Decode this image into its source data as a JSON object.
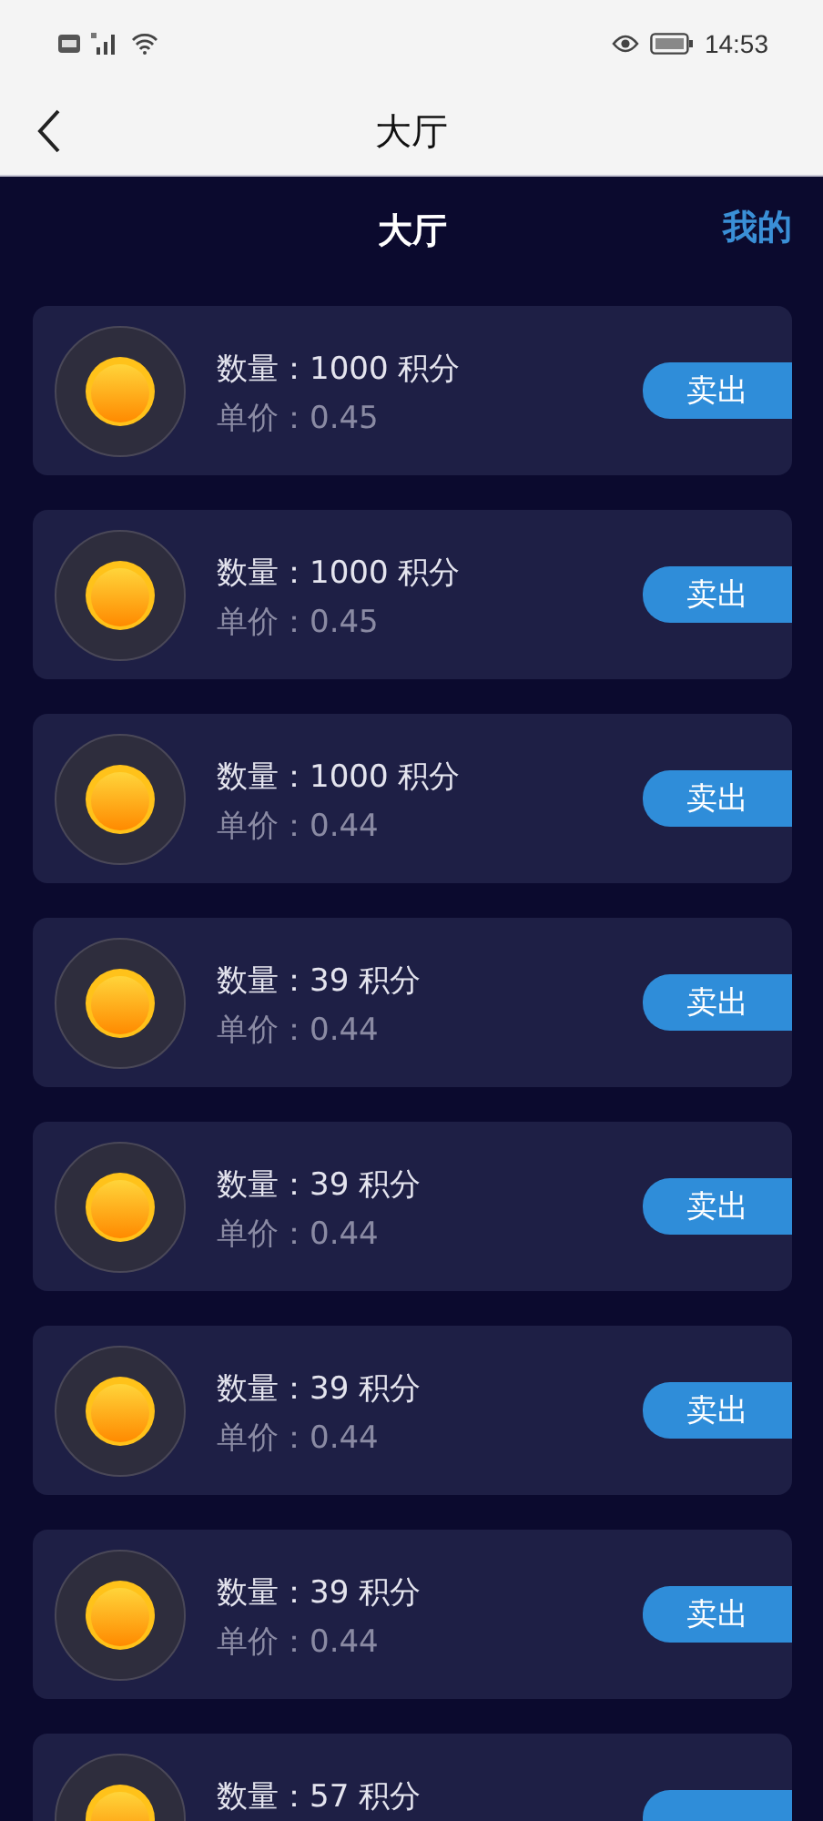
{
  "status_bar": {
    "time": "14:53"
  },
  "nav_bar": {
    "title": "大厅"
  },
  "header": {
    "title": "大厅",
    "link": "我的"
  },
  "listings": [
    {
      "quantity": "数量：1000 积分",
      "price": "单价：0.45",
      "action": "卖出"
    },
    {
      "quantity": "数量：1000 积分",
      "price": "单价：0.45",
      "action": "卖出"
    },
    {
      "quantity": "数量：1000 积分",
      "price": "单价：0.44",
      "action": "卖出"
    },
    {
      "quantity": "数量：39 积分",
      "price": "单价：0.44",
      "action": "卖出"
    },
    {
      "quantity": "数量：39 积分",
      "price": "单价：0.44",
      "action": "卖出"
    },
    {
      "quantity": "数量：39 积分",
      "price": "单价：0.44",
      "action": "卖出"
    },
    {
      "quantity": "数量：39 积分",
      "price": "单价：0.44",
      "action": "卖出"
    },
    {
      "quantity": "数量：57 积分"
    }
  ]
}
